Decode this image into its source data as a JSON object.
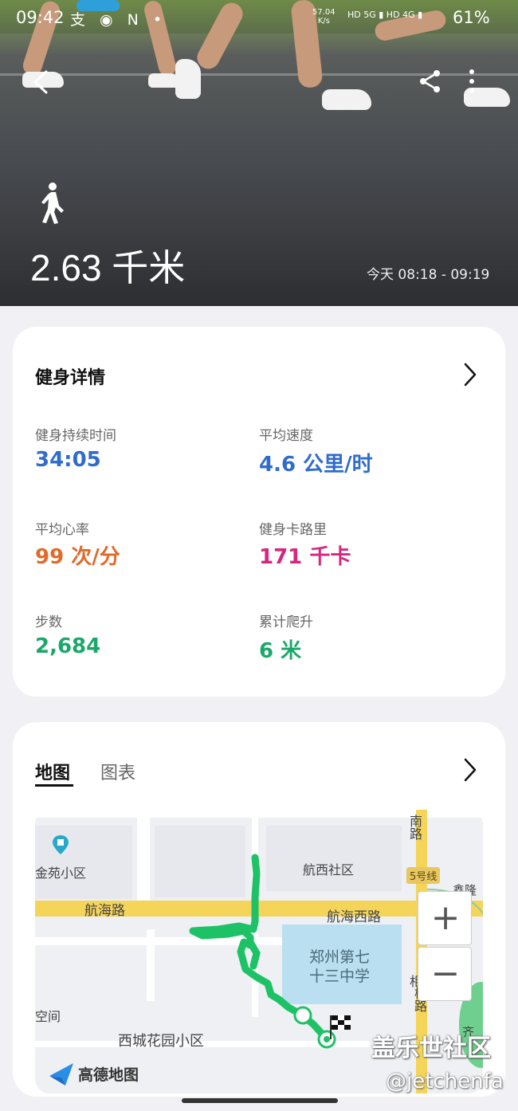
{
  "status_bar": {
    "time": "09:42",
    "left_icons": "支 ◉ N •",
    "net_speed": "57.04",
    "net_unit": "K/s",
    "signals": "HD 5G ▮ HD 4G ▮",
    "battery": "61%"
  },
  "hero": {
    "activity_icon": "walking-icon",
    "distance": "2.63 千米",
    "time_range": "今天 08:18 - 09:19"
  },
  "details": {
    "title": "健身详情",
    "metrics": [
      {
        "label": "健身持续时间",
        "value": "34:05",
        "color": "#2f6ccc"
      },
      {
        "label": "平均速度",
        "value": "4.6 公里/时",
        "color": "#2f6ccc"
      },
      {
        "label": "平均心率",
        "value": "99 次/分",
        "color": "#e06a2a"
      },
      {
        "label": "健身卡路里",
        "value": "171 千卡",
        "color": "#d6267f"
      },
      {
        "label": "步数",
        "value": "2,684",
        "color": "#1aa86a"
      },
      {
        "label": "累计爬升",
        "value": "6 米",
        "color": "#1aa86a"
      }
    ]
  },
  "map_section": {
    "tabs": [
      "地图",
      "图表"
    ],
    "active_tab": "地图",
    "labels": {
      "poi_jinyuan": "金苑小区",
      "poi_hangxi": "航西社区",
      "road_hanghai": "航海路",
      "road_hanghai_west": "航海西路",
      "school_line1": "郑州第七",
      "school_line2": "十三中学",
      "space": "空间",
      "xicheng": "西城花园小区",
      "south_road": "南路",
      "metro": "5号线",
      "xinlong": "鑫隆",
      "xiang_road": "相",
      "xiang_road2": "桐路",
      "qi": "齐"
    },
    "zoom_in": "+",
    "zoom_out": "−",
    "map_brand": "高德地图"
  },
  "watermark": {
    "line1": "盖乐世社区",
    "line2": "@jetchenfa"
  }
}
